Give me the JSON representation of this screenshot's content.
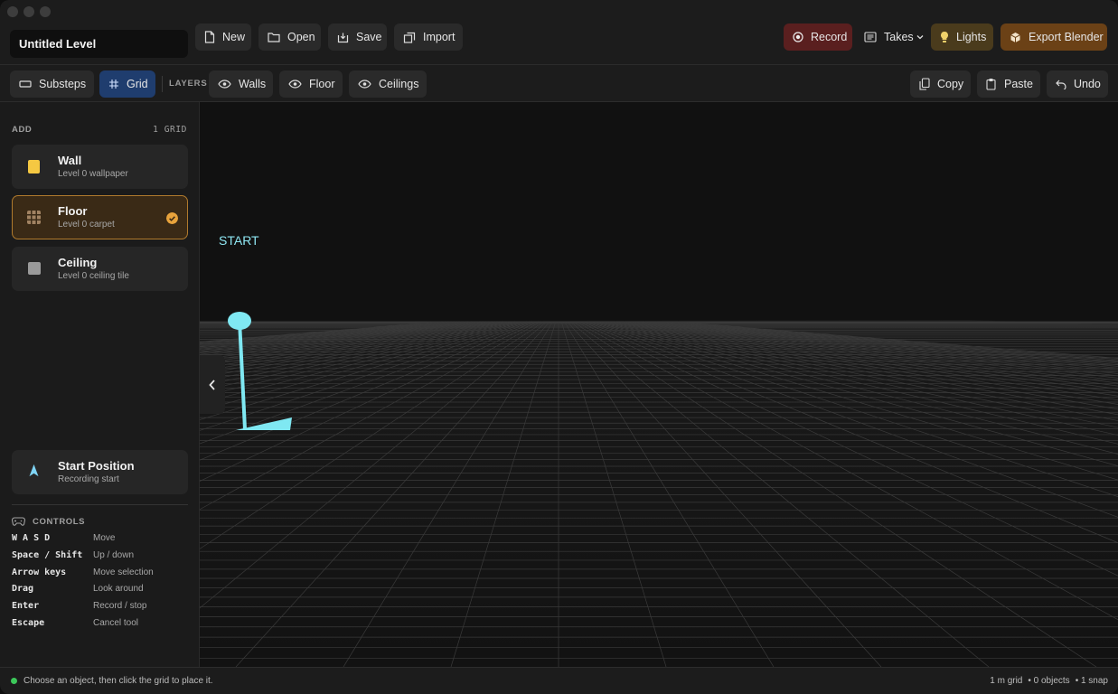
{
  "app": {
    "level_title": "Untitled Level"
  },
  "toolbar": {
    "new_label": "New",
    "open_label": "Open",
    "save_label": "Save",
    "import_label": "Import",
    "record_label": "Record",
    "takes_label": "Takes",
    "lights_label": "Lights",
    "export_label": "Export Blender"
  },
  "subtoolbar": {
    "substeps_label": "Substeps",
    "grid_label": "Grid",
    "layers_label": "LAYERS",
    "walls_label": "Walls",
    "floor_label": "Floor",
    "ceilings_label": "Ceilings",
    "copy_label": "Copy",
    "paste_label": "Paste",
    "undo_label": "Undo"
  },
  "sidebar": {
    "add_label": "ADD",
    "grid_count": "1 GRID",
    "items": [
      {
        "name": "Wall",
        "sub": "Level 0 wallpaper",
        "color": "#f5c842"
      },
      {
        "name": "Floor",
        "sub": "Level 0 carpet",
        "color": "#a08262"
      },
      {
        "name": "Ceiling",
        "sub": "Level 0 ceiling tile",
        "color": "#9a9a9a"
      }
    ],
    "start": {
      "name": "Start Position",
      "sub": "Recording start",
      "color": "#7fd4f5"
    },
    "controls_label": "CONTROLS",
    "controls": [
      {
        "key": "W A S D",
        "desc": "Move"
      },
      {
        "key": "Space / Shift",
        "desc": "Up / down"
      },
      {
        "key": "Arrow keys",
        "desc": "Move selection"
      },
      {
        "key": "Drag",
        "desc": "Look around"
      },
      {
        "key": "Enter",
        "desc": "Record / stop"
      },
      {
        "key": "Escape",
        "desc": "Cancel tool"
      }
    ]
  },
  "viewport": {
    "start_label": "START",
    "marker_color": "#7fe8f2"
  },
  "status": {
    "message": "Choose an object, then click the grid to place it.",
    "grid_size": "1 m grid",
    "objects": "• 0 objects",
    "snap": "• 1 snap"
  }
}
